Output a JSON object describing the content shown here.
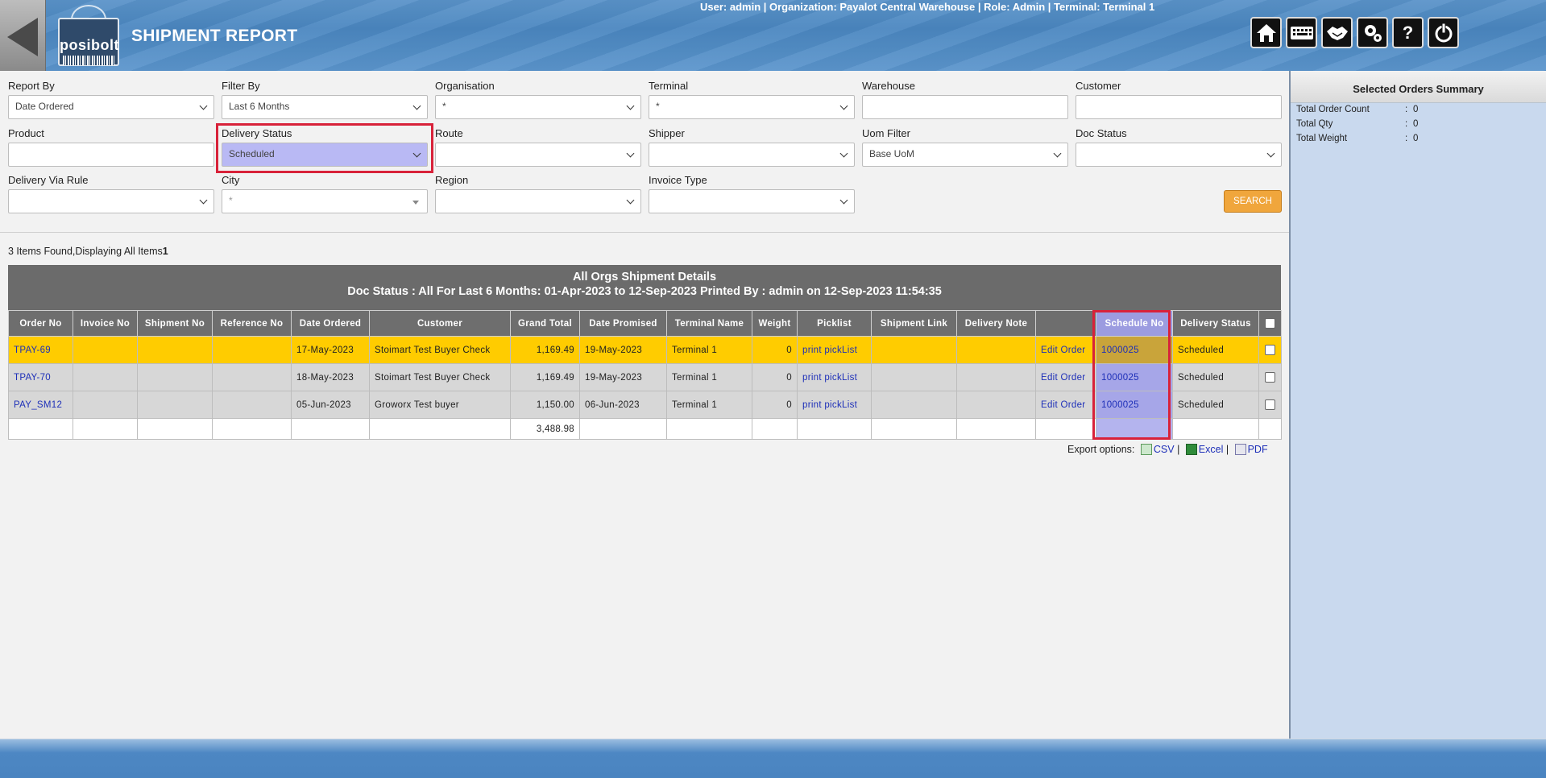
{
  "header": {
    "title": "SHIPMENT REPORT",
    "logo_text": "posibolt",
    "user_info": "User: admin | Organization: Payalot Central Warehouse | Role: Admin | Terminal: Terminal 1",
    "icons": [
      "home-icon",
      "keyboard-icon",
      "handshake-icon",
      "settings-icon",
      "help-icon",
      "logout-icon"
    ],
    "help_glyph": "?"
  },
  "filters": {
    "report_by": {
      "label": "Report By",
      "value": "Date Ordered"
    },
    "filter_by": {
      "label": "Filter By",
      "value": "Last 6 Months"
    },
    "organisation": {
      "label": "Organisation",
      "value": "*"
    },
    "terminal": {
      "label": "Terminal",
      "value": "*"
    },
    "warehouse": {
      "label": "Warehouse",
      "value": ""
    },
    "customer": {
      "label": "Customer",
      "value": ""
    },
    "product": {
      "label": "Product",
      "value": ""
    },
    "delivery_status": {
      "label": "Delivery Status",
      "value": "Scheduled"
    },
    "route": {
      "label": "Route",
      "value": ""
    },
    "shipper": {
      "label": "Shipper",
      "value": ""
    },
    "uom_filter": {
      "label": "Uom Filter",
      "value": "Base UoM"
    },
    "doc_status": {
      "label": "Doc Status",
      "value": ""
    },
    "delivery_via_rule": {
      "label": "Delivery Via Rule",
      "value": ""
    },
    "city": {
      "label": "City",
      "value": "*"
    },
    "region": {
      "label": "Region",
      "value": ""
    },
    "invoice_type": {
      "label": "Invoice Type",
      "value": ""
    },
    "search_label": "SEARCH"
  },
  "results": {
    "found_text": "3 Items Found,Displaying All Items",
    "page": "1"
  },
  "report": {
    "title": "All Orgs Shipment Details",
    "subtitle": "Doc Status : All For Last 6 Months: 01-Apr-2023 to 12-Sep-2023 Printed By : admin on 12-Sep-2023 11:54:35",
    "columns": [
      "Order No",
      "Invoice No",
      "Shipment No",
      "Reference No",
      "Date Ordered",
      "Customer",
      "Grand Total",
      "Date Promised",
      "Terminal Name",
      "Weight",
      "Picklist",
      "Shipment Link",
      "Delivery Note",
      "",
      "Schedule No",
      "Delivery Status"
    ],
    "rows": [
      {
        "order_no": "TPAY-69",
        "invoice_no": "",
        "shipment_no": "",
        "reference_no": "",
        "date_ordered": "17-May-2023",
        "customer": "Stoimart Test Buyer Check",
        "grand_total": "1,169.49",
        "date_promised": "19-May-2023",
        "terminal_name": "Terminal 1",
        "weight": "0",
        "picklist": "print pickList",
        "shipment_link": "",
        "delivery_note": "",
        "edit": "Edit Order",
        "schedule_no": "1000025",
        "delivery_status": "Scheduled"
      },
      {
        "order_no": "TPAY-70",
        "invoice_no": "",
        "shipment_no": "",
        "reference_no": "",
        "date_ordered": "18-May-2023",
        "customer": "Stoimart Test Buyer Check",
        "grand_total": "1,169.49",
        "date_promised": "19-May-2023",
        "terminal_name": "Terminal 1",
        "weight": "0",
        "picklist": "print pickList",
        "shipment_link": "",
        "delivery_note": "",
        "edit": "Edit Order",
        "schedule_no": "1000025",
        "delivery_status": "Scheduled"
      },
      {
        "order_no": "PAY_SM12",
        "invoice_no": "",
        "shipment_no": "",
        "reference_no": "",
        "date_ordered": "05-Jun-2023",
        "customer": "Groworx Test buyer",
        "grand_total": "1,150.00",
        "date_promised": "06-Jun-2023",
        "terminal_name": "Terminal 1",
        "weight": "0",
        "picklist": "print pickList",
        "shipment_link": "",
        "delivery_note": "",
        "edit": "Edit Order",
        "schedule_no": "1000025",
        "delivery_status": "Scheduled"
      }
    ],
    "total_grand_total": "3,488.98"
  },
  "export": {
    "label": "Export options:",
    "csv": "CSV",
    "excel": "Excel",
    "pdf": "PDF",
    "sep": "|"
  },
  "summary": {
    "title": "Selected Orders Summary",
    "rows": [
      {
        "label": "Total Order Count",
        "value": "0"
      },
      {
        "label": "Total Qty",
        "value": "0"
      },
      {
        "label": "Total Weight",
        "value": "0"
      }
    ],
    "colon": ":"
  }
}
